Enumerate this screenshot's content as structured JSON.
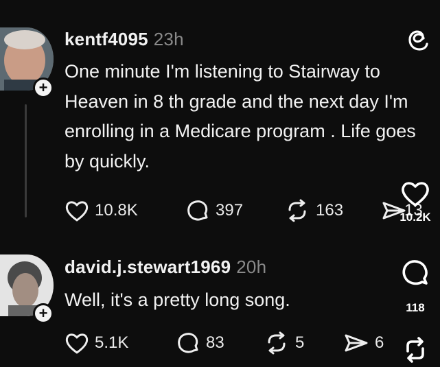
{
  "posts": [
    {
      "username": "kentf4095",
      "time": "23h",
      "text": "One minute I'm listening to Stairway to Heaven in 8 th grade and the next day I'm enrolling in a Medicare program . Life goes by quickly.",
      "likes": "10.8K",
      "replies": "397",
      "reposts": "163",
      "shares": "13"
    },
    {
      "username": "david.j.stewart1969",
      "time": "20h",
      "text": "Well, it's a pretty long song.",
      "likes": "5.1K",
      "replies": "83",
      "reposts": "5",
      "shares": "6"
    }
  ],
  "side_actions": {
    "like_count": "10.2K",
    "comment_count": "118"
  },
  "icons": [
    "threads-logo-icon",
    "heart-icon",
    "comment-icon",
    "repost-icon",
    "send-icon",
    "plus-icon"
  ],
  "colors": {
    "background": "#0d0d0d",
    "text": "#f2f2f2",
    "muted": "#8a8a8a"
  }
}
